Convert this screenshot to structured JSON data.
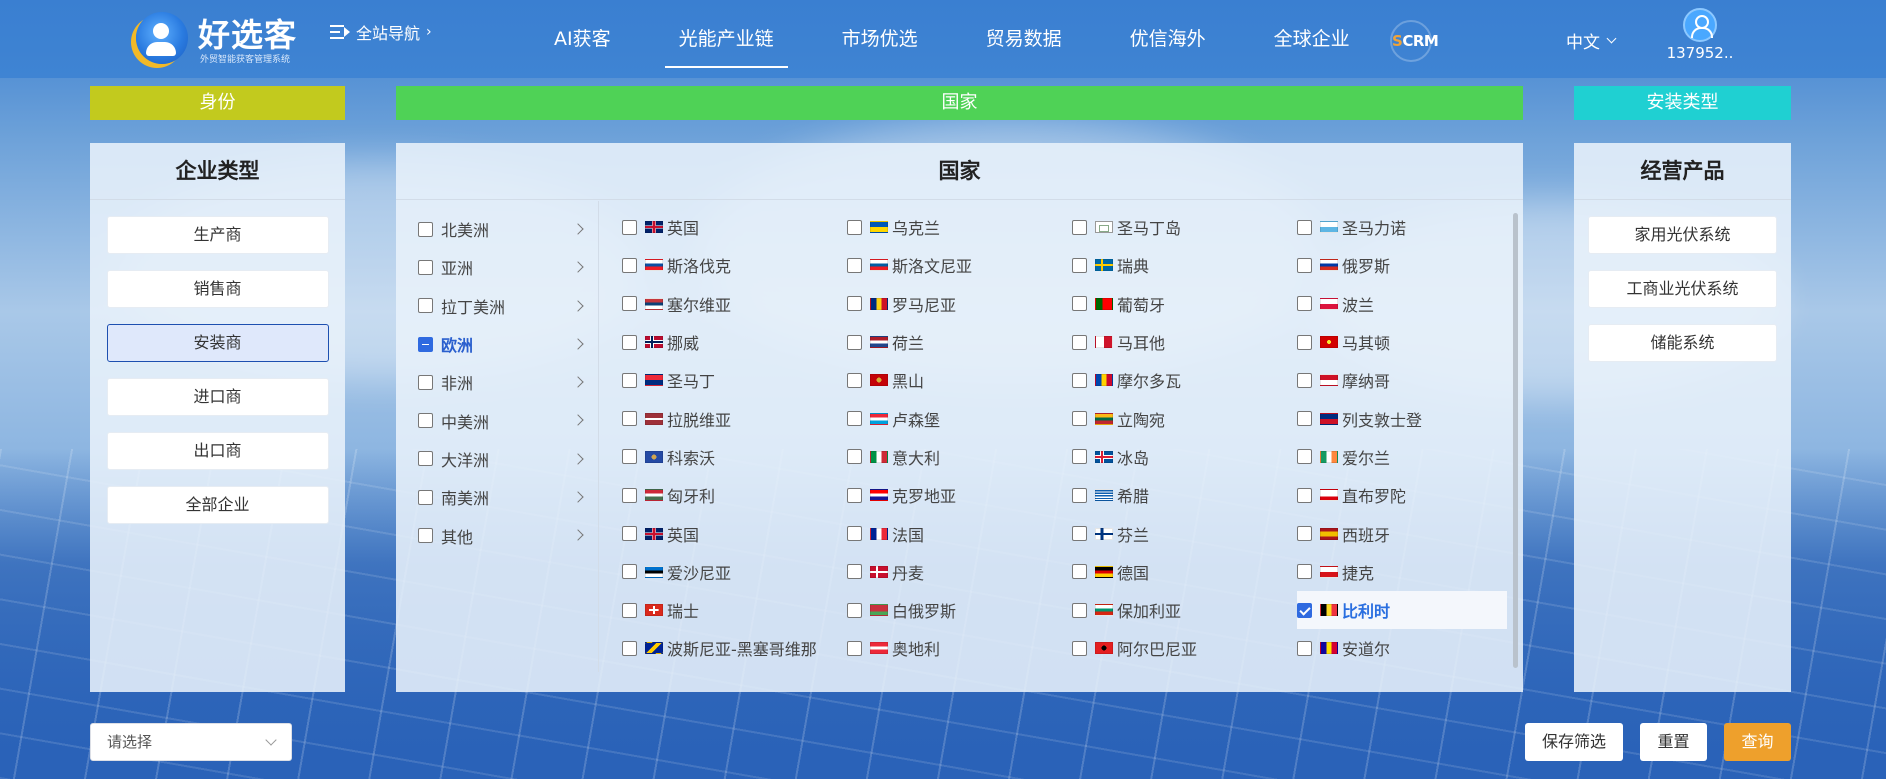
{
  "header": {
    "logo_title": "好选客",
    "logo_subtitle": "外贸智能获客管理系统",
    "all_nav_label": "全站导航",
    "nav": [
      {
        "label": "AI获客",
        "active": false
      },
      {
        "label": "光能产业链",
        "active": true
      },
      {
        "label": "市场优选",
        "active": false
      },
      {
        "label": "贸易数据",
        "active": false
      },
      {
        "label": "优信海外",
        "active": false
      },
      {
        "label": "全球企业",
        "active": false
      }
    ],
    "scrm_s": "S",
    "scrm_rest": "CRM",
    "language": "中文",
    "username": "137952.."
  },
  "categories": {
    "identity": "身份",
    "country": "国家",
    "install": "安装类型"
  },
  "left_panel": {
    "title": "企业类型",
    "options": [
      {
        "label": "生产商",
        "selected": false
      },
      {
        "label": "销售商",
        "selected": false
      },
      {
        "label": "安装商",
        "selected": true
      },
      {
        "label": "进口商",
        "selected": false
      },
      {
        "label": "出口商",
        "selected": false
      },
      {
        "label": "全部企业",
        "selected": false
      }
    ]
  },
  "country_panel": {
    "title": "国家",
    "regions": [
      {
        "label": "北美洲",
        "state": "none"
      },
      {
        "label": "亚洲",
        "state": "none"
      },
      {
        "label": "拉丁美洲",
        "state": "none"
      },
      {
        "label": "欧洲",
        "state": "partial"
      },
      {
        "label": "非洲",
        "state": "none"
      },
      {
        "label": "中美洲",
        "state": "none"
      },
      {
        "label": "大洋洲",
        "state": "none"
      },
      {
        "label": "南美洲",
        "state": "none"
      },
      {
        "label": "其他",
        "state": "none"
      }
    ],
    "countries": [
      {
        "name": "英国",
        "flag": "gb",
        "checked": false
      },
      {
        "name": "乌克兰",
        "flag": "ua",
        "checked": false
      },
      {
        "name": "圣马丁岛",
        "flag": "broken",
        "checked": false
      },
      {
        "name": "圣马力诺",
        "flag": "sm",
        "checked": false
      },
      {
        "name": "斯洛伐克",
        "flag": "sk",
        "checked": false
      },
      {
        "name": "斯洛文尼亚",
        "flag": "si",
        "checked": false
      },
      {
        "name": "瑞典",
        "flag": "se",
        "checked": false
      },
      {
        "name": "俄罗斯",
        "flag": "ru",
        "checked": false
      },
      {
        "name": "塞尔维亚",
        "flag": "rs",
        "checked": false
      },
      {
        "name": "罗马尼亚",
        "flag": "ro",
        "checked": false
      },
      {
        "name": "葡萄牙",
        "flag": "pt",
        "checked": false
      },
      {
        "name": "波兰",
        "flag": "pl",
        "checked": false
      },
      {
        "name": "挪威",
        "flag": "no",
        "checked": false
      },
      {
        "name": "荷兰",
        "flag": "nl",
        "checked": false
      },
      {
        "name": "马耳他",
        "flag": "mt",
        "checked": false
      },
      {
        "name": "马其顿",
        "flag": "mk",
        "checked": false
      },
      {
        "name": "圣马丁",
        "flag": "sx",
        "checked": false
      },
      {
        "name": "黑山",
        "flag": "me",
        "checked": false
      },
      {
        "name": "摩尔多瓦",
        "flag": "md",
        "checked": false
      },
      {
        "name": "摩纳哥",
        "flag": "mc",
        "checked": false
      },
      {
        "name": "拉脱维亚",
        "flag": "lv",
        "checked": false
      },
      {
        "name": "卢森堡",
        "flag": "lu",
        "checked": false
      },
      {
        "name": "立陶宛",
        "flag": "lt",
        "checked": false
      },
      {
        "name": "列支敦士登",
        "flag": "li",
        "checked": false
      },
      {
        "name": "科索沃",
        "flag": "xk",
        "checked": false
      },
      {
        "name": "意大利",
        "flag": "it",
        "checked": false
      },
      {
        "name": "冰岛",
        "flag": "is",
        "checked": false
      },
      {
        "name": "爱尔兰",
        "flag": "ie",
        "checked": false
      },
      {
        "name": "匈牙利",
        "flag": "hu",
        "checked": false
      },
      {
        "name": "克罗地亚",
        "flag": "hr",
        "checked": false
      },
      {
        "name": "希腊",
        "flag": "gr",
        "checked": false
      },
      {
        "name": "直布罗陀",
        "flag": "gi",
        "checked": false
      },
      {
        "name": "英国",
        "flag": "gb",
        "checked": false
      },
      {
        "name": "法国",
        "flag": "fr",
        "checked": false
      },
      {
        "name": "芬兰",
        "flag": "fi",
        "checked": false
      },
      {
        "name": "西班牙",
        "flag": "es",
        "checked": false
      },
      {
        "name": "爱沙尼亚",
        "flag": "ee",
        "checked": false
      },
      {
        "name": "丹麦",
        "flag": "dk",
        "checked": false
      },
      {
        "name": "德国",
        "flag": "de",
        "checked": false
      },
      {
        "name": "捷克",
        "flag": "cz",
        "checked": false
      },
      {
        "name": "瑞士",
        "flag": "ch",
        "checked": false
      },
      {
        "name": "白俄罗斯",
        "flag": "by",
        "checked": false
      },
      {
        "name": "保加利亚",
        "flag": "bg",
        "checked": false
      },
      {
        "name": "比利时",
        "flag": "be",
        "checked": true
      },
      {
        "name": "波斯尼亚-黑塞哥维那",
        "flag": "ba",
        "checked": false
      },
      {
        "name": "奥地利",
        "flag": "at",
        "checked": false
      },
      {
        "name": "阿尔巴尼亚",
        "flag": "al",
        "checked": false
      },
      {
        "name": "安道尔",
        "flag": "ad",
        "checked": false
      }
    ]
  },
  "right_panel": {
    "title": "经营产品",
    "options": [
      {
        "label": "家用光伏系统"
      },
      {
        "label": "工商业光伏系统"
      },
      {
        "label": "储能系统"
      }
    ]
  },
  "footer": {
    "select_placeholder": "请选择",
    "save_label": "保存筛选",
    "reset_label": "重置",
    "query_label": "查询"
  },
  "colors": {
    "identity_bar": "#c2ca1e",
    "country_bar": "#4fd256",
    "install_bar": "#1fd0d2",
    "query_button": "#eea02c",
    "checkbox_accent": "#2f6ae0"
  }
}
